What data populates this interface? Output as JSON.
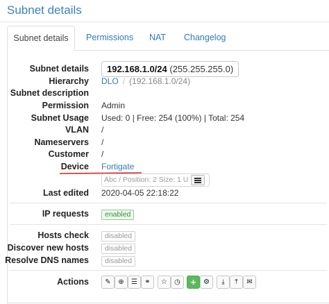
{
  "page_title": "Subnet details",
  "tabs": [
    {
      "label": "Subnet details",
      "active": true
    },
    {
      "label": "Permissions",
      "active": false
    },
    {
      "label": "NAT",
      "active": false
    },
    {
      "label": "Changelog",
      "active": false
    }
  ],
  "labels": {
    "subnet_details": "Subnet details",
    "hierarchy": "Hierarchy",
    "subnet_description": "Subnet description",
    "permission": "Permission",
    "subnet_usage": "Subnet Usage",
    "vlan": "VLAN",
    "nameservers": "Nameservers",
    "customer": "Customer",
    "device": "Device",
    "last_edited": "Last edited",
    "ip_requests": "IP requests",
    "hosts_check": "Hosts check",
    "discover_new_hosts": "Discover new hosts",
    "resolve_dns_names": "Resolve DNS names",
    "actions": "Actions"
  },
  "values": {
    "subnet_address": "192.168.1.0/24",
    "subnet_mask": "(255.255.255.0)",
    "hierarchy_parent": "DLO",
    "hierarchy_separator": "/",
    "hierarchy_child": "(192.168.1.0/24)",
    "permission": "Admin",
    "subnet_usage": "Used: 0 | Free: 254 (100%) | Total: 254",
    "vlan": "/",
    "nameservers": "/",
    "customer": "/",
    "device": "Fortigate",
    "device_position_placeholder": "Abc / Position: 2 Size: 1 U",
    "last_edited": "2020-04-05 22:18:22",
    "ip_requests": "enabled",
    "hosts_check": "disabled",
    "discover_new_hosts": "disabled",
    "resolve_dns_names": "disabled"
  },
  "actions": [
    {
      "name": "edit-icon",
      "glyph": "✎"
    },
    {
      "name": "add-circle-icon",
      "glyph": "⊕"
    },
    {
      "name": "list-icon",
      "glyph": "☰"
    },
    {
      "name": "link-icon",
      "glyph": "⚭"
    },
    {
      "name": "star-icon",
      "glyph": "☆"
    },
    {
      "name": "clock-icon",
      "glyph": "◷"
    },
    {
      "name": "plus-icon",
      "glyph": "+"
    },
    {
      "name": "cogs-icon",
      "glyph": "⚙"
    },
    {
      "name": "download-icon",
      "glyph": "⤓"
    },
    {
      "name": "upload-icon",
      "glyph": "⤒"
    },
    {
      "name": "mail-icon",
      "glyph": "✉"
    }
  ],
  "colors": {
    "link": "#337ab7",
    "annotation_underline": "#e02020",
    "enabled_badge": "#5cb85c"
  }
}
